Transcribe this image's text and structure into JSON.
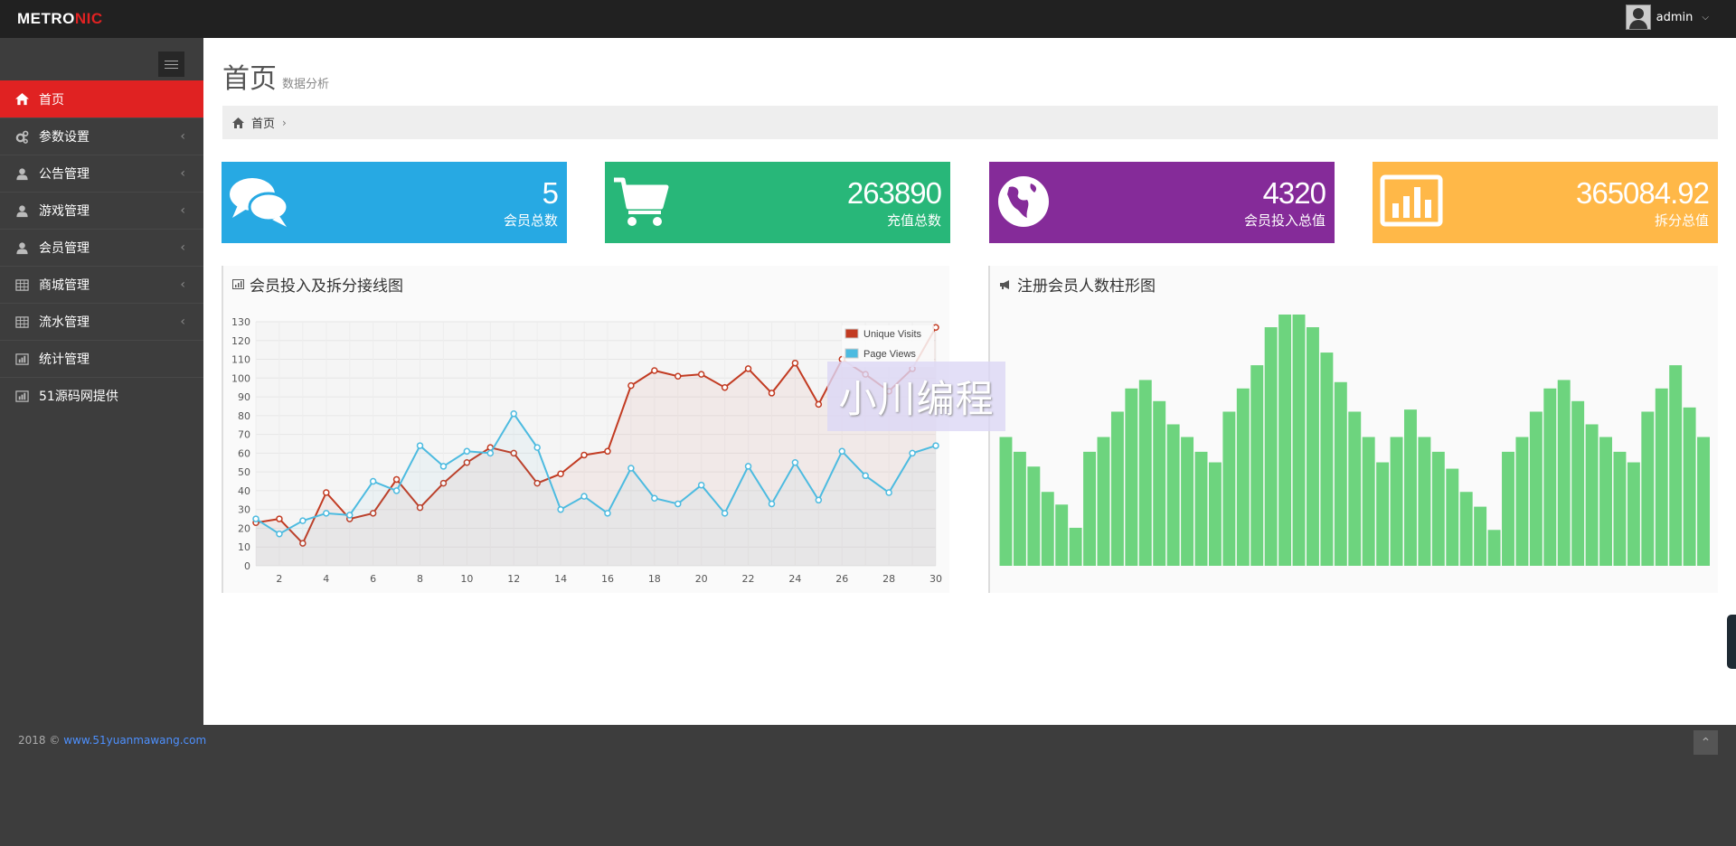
{
  "app": {
    "logo_main": "METRO",
    "logo_accent": "NIC",
    "user_name": "admin"
  },
  "sidebar": {
    "items": [
      {
        "label": "首页",
        "icon": "home-icon",
        "active": true,
        "has_arrow": false
      },
      {
        "label": "参数设置",
        "icon": "cogs-icon",
        "active": false,
        "has_arrow": true
      },
      {
        "label": "公告管理",
        "icon": "user-icon",
        "active": false,
        "has_arrow": true
      },
      {
        "label": "游戏管理",
        "icon": "user-icon",
        "active": false,
        "has_arrow": true
      },
      {
        "label": "会员管理",
        "icon": "user-icon",
        "active": false,
        "has_arrow": true
      },
      {
        "label": "商城管理",
        "icon": "table-icon",
        "active": false,
        "has_arrow": true
      },
      {
        "label": "流水管理",
        "icon": "table-icon",
        "active": false,
        "has_arrow": true
      },
      {
        "label": "统计管理",
        "icon": "bar-chart-icon",
        "active": false,
        "has_arrow": false
      },
      {
        "label": "51源码网提供",
        "icon": "bar-chart-icon",
        "active": false,
        "has_arrow": false
      }
    ]
  },
  "page": {
    "title": "首页",
    "subtitle": "数据分析",
    "breadcrumb": "首页"
  },
  "stats": [
    {
      "value": "5",
      "label": "会员总数",
      "color": "#27a9e3",
      "icon": "comments-icon"
    },
    {
      "value": "263890",
      "label": "充值总数",
      "color": "#28b779",
      "icon": "shopping-cart-icon"
    },
    {
      "value": "4320",
      "label": "会员投入总值",
      "color": "#852b99",
      "icon": "globe-icon"
    },
    {
      "value": "365084.92",
      "label": "拆分总值",
      "color": "#ffb848",
      "icon": "bar-chart-icon"
    }
  ],
  "panels": {
    "line_title": "会员投入及拆分接线图",
    "bar_title": "注册会员人数柱形图"
  },
  "watermark": "小川编程",
  "footer": {
    "year": "2018 ©",
    "link": "www.51yuanmawang.com"
  },
  "chart_data": [
    {
      "type": "line",
      "title": "会员投入及拆分接线图",
      "ylim": [
        0,
        130
      ],
      "yticks": [
        0,
        10,
        20,
        30,
        40,
        50,
        60,
        70,
        80,
        90,
        100,
        110,
        120,
        130
      ],
      "xticks": [
        2,
        4,
        6,
        8,
        10,
        12,
        14,
        16,
        18,
        20,
        22,
        24,
        26,
        28,
        30
      ],
      "xlim": [
        1,
        30
      ],
      "legend_position": "top-right",
      "grid": true,
      "x": [
        1,
        2,
        3,
        4,
        5,
        6,
        7,
        8,
        9,
        10,
        11,
        12,
        13,
        14,
        15,
        16,
        17,
        18,
        19,
        20,
        21,
        22,
        23,
        24,
        25,
        26,
        27,
        28,
        29,
        30
      ],
      "series": [
        {
          "name": "Unique Visits",
          "color": "#c23b22",
          "values": [
            23,
            25,
            12,
            39,
            25,
            28,
            46,
            31,
            44,
            55,
            63,
            60,
            44,
            49,
            59,
            61,
            96,
            104,
            101,
            102,
            95,
            105,
            92,
            108,
            86,
            110,
            102,
            93,
            105,
            127
          ]
        },
        {
          "name": "Page Views",
          "color": "#4dbbe0",
          "values": [
            25,
            17,
            24,
            28,
            27,
            45,
            40,
            64,
            53,
            61,
            60,
            81,
            63,
            30,
            37,
            28,
            52,
            36,
            33,
            43,
            28,
            53,
            33,
            55,
            35,
            61,
            48,
            39,
            60,
            64
          ]
        }
      ]
    },
    {
      "type": "bar",
      "title": "注册会员人数柱形图",
      "color": "#6dd47e",
      "values": [
        61,
        54,
        47,
        35,
        29,
        18,
        54,
        61,
        73,
        84,
        88,
        78,
        67,
        61,
        54,
        49,
        73,
        84,
        95,
        113,
        119,
        119,
        113,
        101,
        87,
        73,
        61,
        49,
        61,
        74,
        61,
        54,
        46,
        35,
        28,
        17,
        54,
        61,
        73,
        84,
        88,
        78,
        67,
        61,
        54,
        49,
        73,
        84,
        95,
        75,
        61
      ],
      "ylim": [
        0,
        125
      ]
    }
  ]
}
